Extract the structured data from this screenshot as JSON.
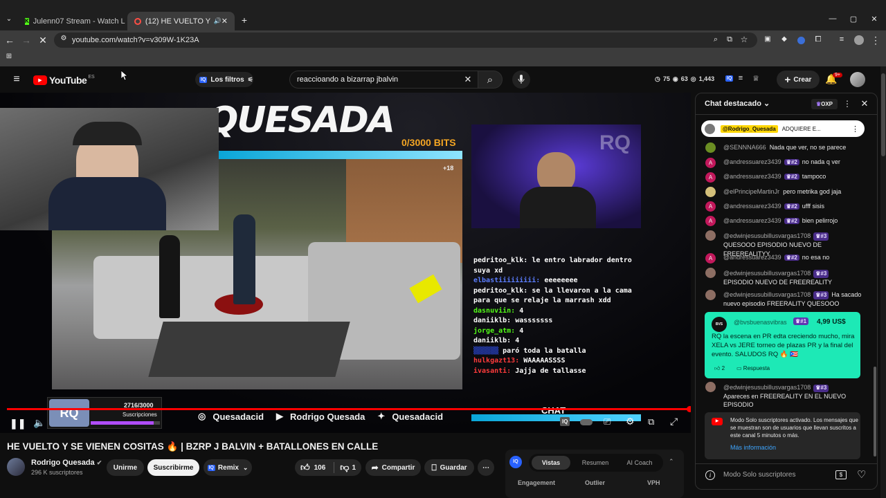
{
  "browser": {
    "tabs": [
      {
        "title": "Julenn07 Stream - Watch Live o"
      },
      {
        "title": "(12) HE VUELTO Y SE VIENEN"
      }
    ],
    "url": "youtube.com/watch?v=v309W-1K23A"
  },
  "header": {
    "logo_text": "YouTube",
    "region": "ES",
    "filters_label": "Los filtros",
    "search_value": "reaccioando a bizarrap jbalvin",
    "stats": {
      "a": "75",
      "b": "63",
      "c": "1,443"
    },
    "create_label": "Crear",
    "notif_count": "9+"
  },
  "overlay": {
    "channel_banner": "QUESADA",
    "bits": "0/3000 BITS",
    "age_badge": "+18",
    "subs_count": "2716/3000",
    "subs_label": "Suscripciones",
    "socials": [
      "Quesadacid",
      "Rodrigo Quesada",
      "Quesadacid"
    ],
    "chat_label": "CHAT",
    "stream_chat": [
      {
        "user": "pedritoo_klk:",
        "text": "le entro labrador dentro suya xd"
      },
      {
        "user": "elbastiiiiiiiii:",
        "text": "eeeeeeee"
      },
      {
        "user": "pedritoo_klk:",
        "text": "se la llevaron a la cama para que se relaje la marrash xdd"
      },
      {
        "user": "dasnuviin:",
        "text": "4"
      },
      {
        "user": "daniiklb:",
        "text": "wasssssss"
      },
      {
        "user": "jorge_atm:",
        "text": "4"
      },
      {
        "user": "daniiklb:",
        "text": "4"
      },
      {
        "user": "",
        "text": "paró toda la batalla"
      },
      {
        "user": "hulkgazt13:",
        "text": "WAAAAASSSS"
      },
      {
        "user": "ivasanti:",
        "text": "Jajja de tallasse"
      }
    ]
  },
  "video": {
    "title": "HE VUELTO Y SE VIENEN COSITAS 🔥 | BZRP J BALVIN + BATALLONES EN CALLE",
    "channel": "Rodrigo Quesada",
    "subscribers": "296 K suscriptores",
    "join_label": "Unirme",
    "subscribe_label": "Suscribirme",
    "remix_label": "Remix",
    "likes": "106",
    "dislikes": "1",
    "share_label": "Compartir",
    "save_label": "Guardar"
  },
  "iq_panel": {
    "tabs": [
      "Vistas",
      "Resumen",
      "AI Coach"
    ],
    "cols": [
      "Engagement",
      "Outlier",
      "VPH"
    ]
  },
  "chat": {
    "title": "Chat destacado",
    "xp_label": "OXP",
    "pinned": {
      "user": "@Rodrigo_Quesada",
      "text": "ADQUIERE E..."
    },
    "messages": [
      {
        "user": "@SENNNA666",
        "badge": "",
        "text": "Nada que ver, no se parece",
        "avatar_color": "#6b8e23"
      },
      {
        "user": "@andressuarez3439",
        "badge": "#2",
        "text": "no nada q ver",
        "avatar_color": "#c2185b"
      },
      {
        "user": "@andressuarez3439",
        "badge": "#2",
        "text": "tampoco",
        "avatar_color": "#c2185b"
      },
      {
        "user": "@elPrincipeMartinJr",
        "badge": "",
        "text": "pero metrika god jaja",
        "avatar_color": "#d4c07a"
      },
      {
        "user": "@andressuarez3439",
        "badge": "#2",
        "text": "ufff sisis",
        "avatar_color": "#c2185b"
      },
      {
        "user": "@andressuarez3439",
        "badge": "#2",
        "text": "bien pelirrojo",
        "avatar_color": "#c2185b"
      },
      {
        "user": "@edwinjesusubillusvargas1708",
        "badge": "#3",
        "text": "QUESOOO EPISODIO NUEVO DE FREEREALITYY",
        "avatar_color": "#8d6e63"
      },
      {
        "user": "@andressuarez3439",
        "badge": "#2",
        "text": "no esa no",
        "avatar_color": "#c2185b"
      },
      {
        "user": "@edwinjesusubillusvargas1708",
        "badge": "#3",
        "text": "EPISODIO NUEVO DE FREEREALITY",
        "avatar_color": "#8d6e63"
      },
      {
        "user": "@edwinjesusubillusvargas1708",
        "badge": "#3",
        "text": "Ha sacado nuevo episodio FREERALITY QUESOOO",
        "avatar_color": "#8d6e63"
      }
    ],
    "superchat": {
      "user": "@bvsbuenasvibras",
      "badge": "#1",
      "amount": "4,99 US$",
      "text": "RQ la escena en PR edta creciendo mucho, mira XELA vs JERE torneo de plazas PR y la final del evento. SALUDOS RQ 🔥 🇵🇷",
      "likes": "2",
      "reply_label": "Respuesta"
    },
    "last": {
      "user": "@edwinjesusubillusvargas1708",
      "badge": "#3",
      "text": "Apareces en FREEREALITY EN EL NUEVO EPISODIO"
    },
    "notice_text": "Modo Solo suscriptores activado. Los mensajes que se muestran son de usuarios que llevan suscritos a este canal 5 minutos o más.",
    "notice_link": "Más información",
    "input_placeholder": "Modo Solo suscriptores"
  },
  "colors": {
    "accent": "#3ea6ff",
    "superchat": "#1de9b6",
    "red": "#ff0000"
  }
}
